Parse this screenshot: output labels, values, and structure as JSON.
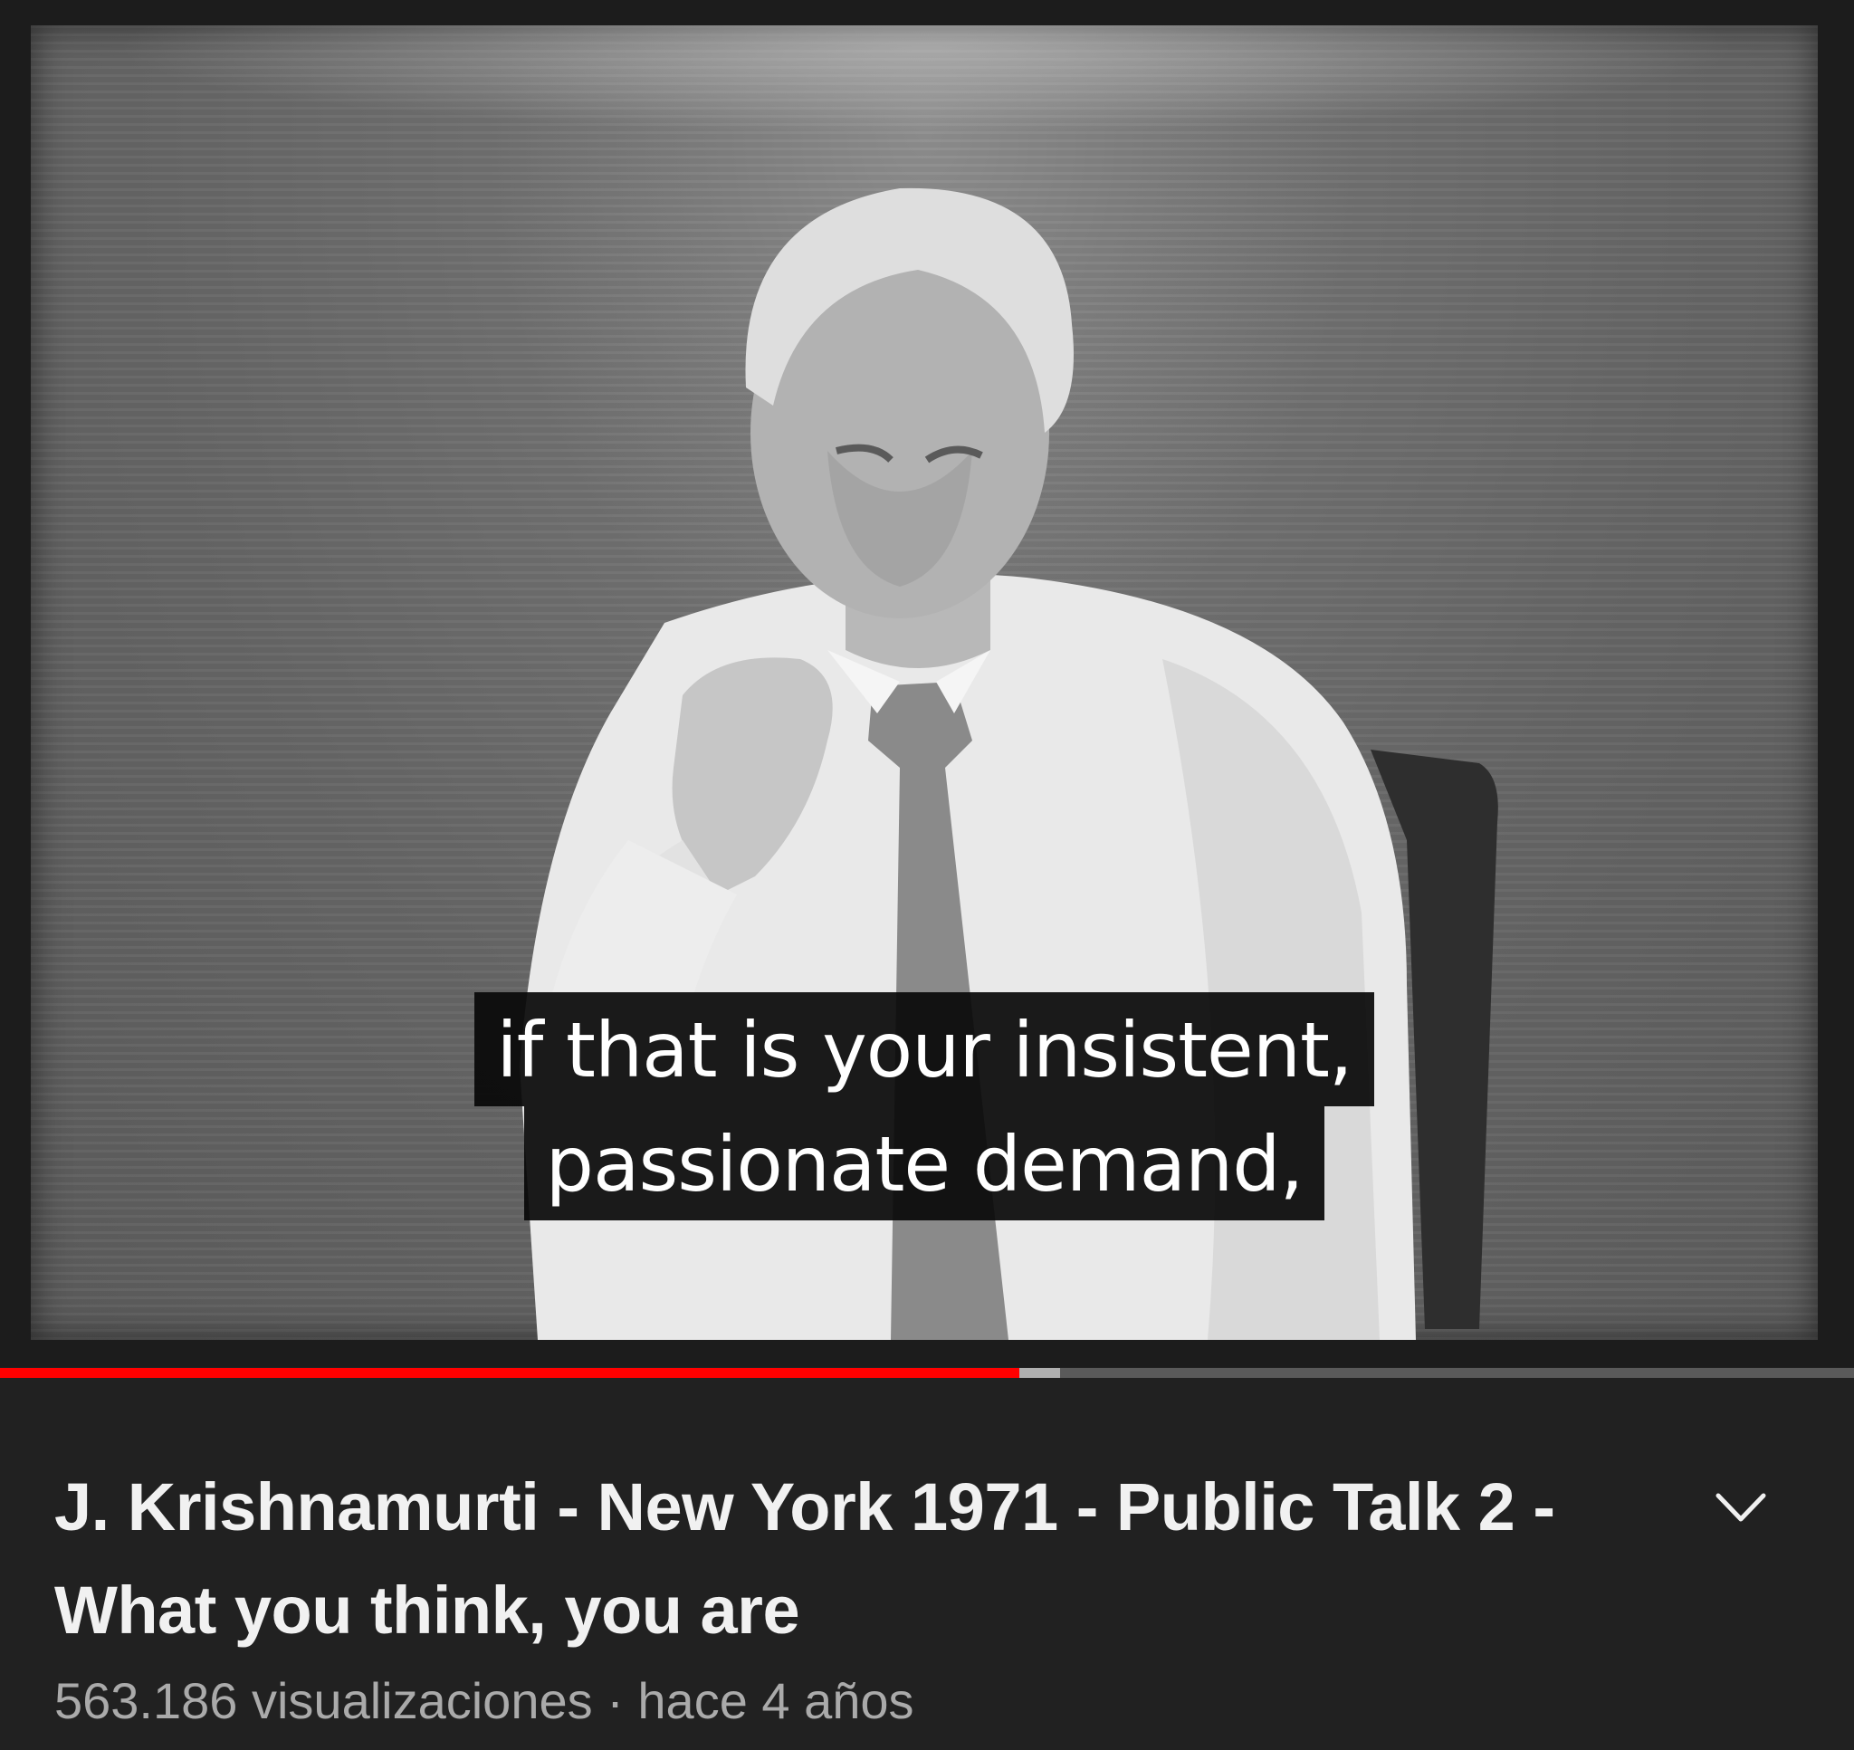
{
  "player": {
    "captions": [
      "if that is your insistent,",
      "passionate demand,"
    ],
    "progress": {
      "played_fraction": 0.55,
      "buffered_fraction": 0.572
    },
    "colors": {
      "progress_played": "#ff0000",
      "progress_buffered": "#b0b0b0",
      "progress_track": "#5a5a5a"
    }
  },
  "video": {
    "title": "J. Krishnamurti - New York 1971 - Public Talk 2 - What you think, you are",
    "views": "563.186 visualizaciones",
    "separator": "·",
    "age": "hace 4 años",
    "expand_icon": "chevron-down-icon"
  }
}
